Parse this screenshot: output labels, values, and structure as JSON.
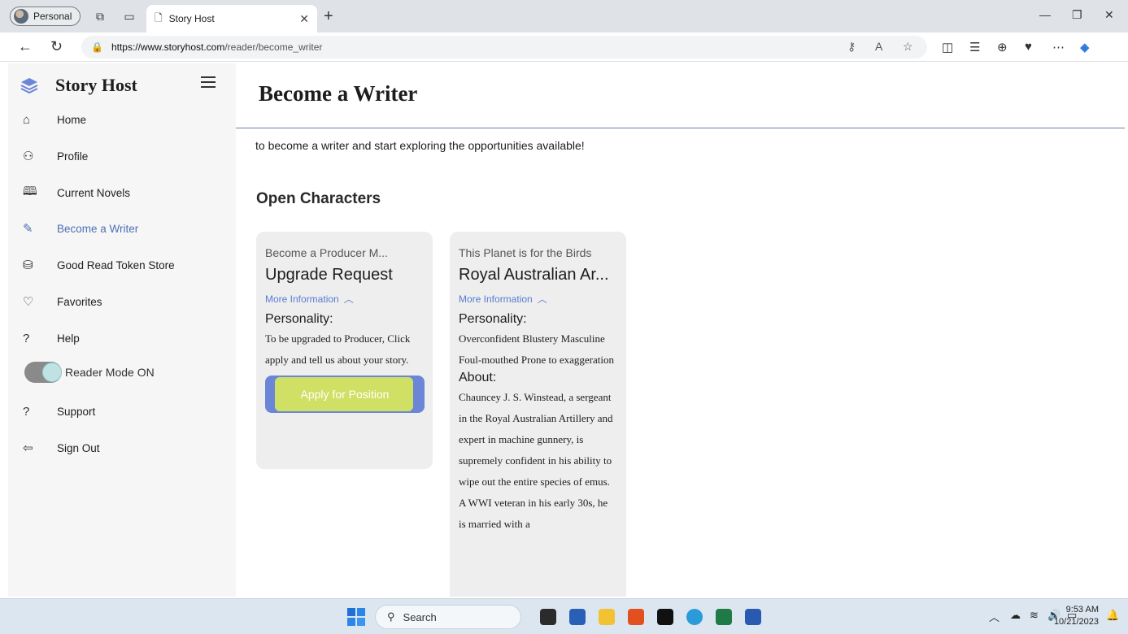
{
  "browser": {
    "profile_label": "Personal",
    "tab_title": "Story Host",
    "url_host": "https://www.storyhost.com",
    "url_path": "/reader/become_writer"
  },
  "sidebar": {
    "brand": "Story Host",
    "items": [
      {
        "label": "Home",
        "icon": "home-icon"
      },
      {
        "label": "Profile",
        "icon": "user-icon"
      },
      {
        "label": "Current Novels",
        "icon": "book-icon"
      },
      {
        "label": "Become a Writer",
        "icon": "pencil-icon",
        "active": true
      },
      {
        "label": "Good Read Token Store",
        "icon": "token-icon"
      },
      {
        "label": "Favorites",
        "icon": "heart-icon"
      },
      {
        "label": "Help",
        "icon": "help-icon"
      },
      {
        "label": "Support",
        "icon": "support-icon"
      },
      {
        "label": "Sign Out",
        "icon": "sign-out-icon"
      }
    ],
    "reader_mode_label": "Reader Mode ON",
    "reader_mode_on": true
  },
  "main": {
    "title": "Become a Writer",
    "intro": "to become a writer and start exploring the opportunities available!",
    "section_title": "Open Characters",
    "cards": [
      {
        "story": "Become a Producer M...",
        "character": "Upgrade Request",
        "more_label": "More Information",
        "personality_label": "Personality:",
        "personality": "To be upgraded to Producer, Click apply and tell us about your story.",
        "apply_label": "Apply for Position"
      },
      {
        "story": "This Planet is for the Birds",
        "character": "Royal Australian Ar...",
        "more_label": "More Information",
        "personality_label": "Personality:",
        "personality": "Overconfident Blustery Masculine Foul-mouthed Prone to exaggeration",
        "about_label": "About:",
        "about": "Chauncey J. S. Winstead, a sergeant in the Royal Australian Artillery and expert in machine gunnery, is supremely confident in his ability to wipe out the entire species of emus. A WWI veteran in his early 30s, he is married with a"
      }
    ]
  },
  "taskbar": {
    "search_label": "Search",
    "time": "9:53 AM",
    "date": "10/21/2023"
  },
  "colors": {
    "accent": "#4f6fb5",
    "button": "#6b86d6",
    "highlight": "#d8e85a"
  }
}
